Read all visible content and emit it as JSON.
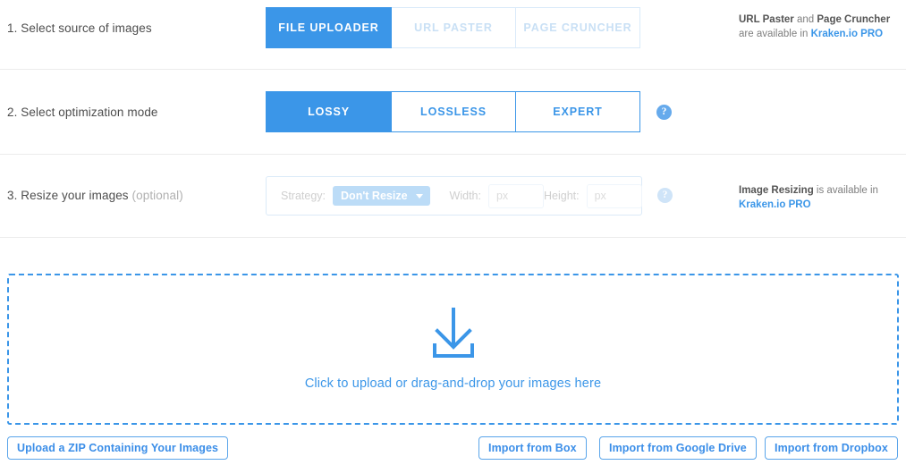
{
  "steps": [
    {
      "label": "1. Select source of images",
      "optional": "",
      "tabs": [
        {
          "label": "FILE UPLOADER",
          "state": "active"
        },
        {
          "label": "URL PASTER",
          "state": "disabled"
        },
        {
          "label": "PAGE CRUNCHER",
          "state": "disabled"
        }
      ],
      "promo": {
        "bold1": "URL Paster",
        "mid1": " and ",
        "bold2": "Page Cruncher",
        "line2_pre": "are available in ",
        "link": "Kraken.io PRO"
      }
    },
    {
      "label": "2. Select optimization mode",
      "tabs": [
        {
          "label": "LOSSY",
          "state": "active"
        },
        {
          "label": "LOSSLESS",
          "state": "enabled"
        },
        {
          "label": "EXPERT",
          "state": "enabled"
        }
      ],
      "help_icon": "question-mark-icon",
      "help_glyph": "?"
    },
    {
      "label": "3. Resize your images ",
      "optional": "(optional)",
      "resize": {
        "strategy_label": "Strategy:",
        "strategy_value": "Don't Resize",
        "width_label": "Width:",
        "width_value": "",
        "width_placeholder": "px",
        "height_label": "Height:",
        "height_value": "",
        "height_placeholder": "px"
      },
      "help_icon": "question-mark-icon",
      "help_glyph": "?",
      "promo": {
        "bold1": "Image Resizing",
        "mid1": " is available in",
        "link": "Kraken.io PRO"
      }
    }
  ],
  "dropzone": {
    "icon": "download-arrow-icon",
    "text": "Click to upload or drag-and-drop your images here"
  },
  "footer": {
    "zip_button": "Upload a ZIP Containing Your Images",
    "import_buttons": [
      "Import from Box",
      "Import from Google Drive",
      "Import from Dropbox"
    ]
  },
  "colors": {
    "accent": "#3b96e8",
    "accent_muted": "#bcdcf7",
    "divider": "#ececec",
    "text": "#4d4d4d"
  }
}
